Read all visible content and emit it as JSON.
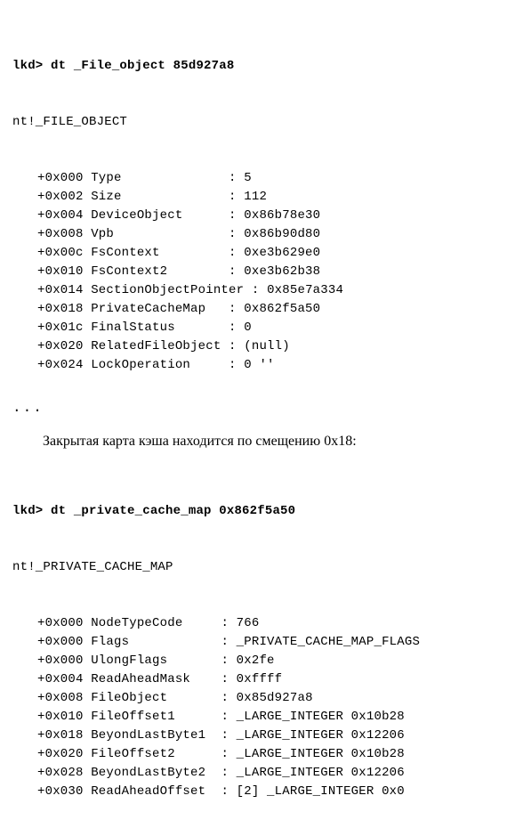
{
  "block1": {
    "prompt": "lkd>",
    "command": "dt _File_object 85d927a8",
    "struct": "nt!_FILE_OBJECT",
    "fields": [
      {
        "off": "+0x000",
        "name": "Type",
        "val": "5"
      },
      {
        "off": "+0x002",
        "name": "Size",
        "val": "112"
      },
      {
        "off": "+0x004",
        "name": "DeviceObject",
        "val": "0x86b78e30"
      },
      {
        "off": "+0x008",
        "name": "Vpb",
        "val": "0x86b90d80"
      },
      {
        "off": "+0x00c",
        "name": "FsContext",
        "val": "0xe3b629e0"
      },
      {
        "off": "+0x010",
        "name": "FsContext2",
        "val": "0xe3b62b38"
      },
      {
        "off": "+0x014",
        "name": "SectionObjectPointer",
        "val": "0x85e7a334"
      },
      {
        "off": "+0x018",
        "name": "PrivateCacheMap",
        "val": "0x862f5a50"
      },
      {
        "off": "+0x01c",
        "name": "FinalStatus",
        "val": "0"
      },
      {
        "off": "+0x020",
        "name": "RelatedFileObject",
        "val": "(null)"
      },
      {
        "off": "+0x024",
        "name": "LockOperation",
        "val": "0 ''"
      }
    ]
  },
  "ellipsis": "...",
  "paragraph": "Закрытая карта кэша находится по смещению 0x18:",
  "block2": {
    "prompt": "lkd>",
    "command": "dt _private_cache_map 0x862f5a50",
    "struct": "nt!_PRIVATE_CACHE_MAP",
    "fields": [
      {
        "off": "+0x000",
        "name": "NodeTypeCode",
        "val": "766"
      },
      {
        "off": "+0x000",
        "name": "Flags",
        "val": "_PRIVATE_CACHE_MAP_FLAGS"
      },
      {
        "off": "+0x000",
        "name": "UlongFlags",
        "val": "0x2fe"
      },
      {
        "off": "+0x004",
        "name": "ReadAheadMask",
        "val": "0xffff"
      },
      {
        "off": "+0x008",
        "name": "FileObject",
        "val": "0x85d927a8"
      },
      {
        "off": "+0x010",
        "name": "FileOffset1",
        "val": "_LARGE_INTEGER 0x10b28"
      },
      {
        "off": "+0x018",
        "name": "BeyondLastByte1",
        "val": "_LARGE_INTEGER 0x12206"
      },
      {
        "off": "+0x020",
        "name": "FileOffset2",
        "val": "_LARGE_INTEGER 0x10b28"
      },
      {
        "off": "+0x028",
        "name": "BeyondLastByte2",
        "val": "_LARGE_INTEGER 0x12206"
      },
      {
        "off": "+0x030",
        "name": "ReadAheadOffset",
        "val": "[2] _LARGE_INTEGER 0x0"
      }
    ]
  }
}
